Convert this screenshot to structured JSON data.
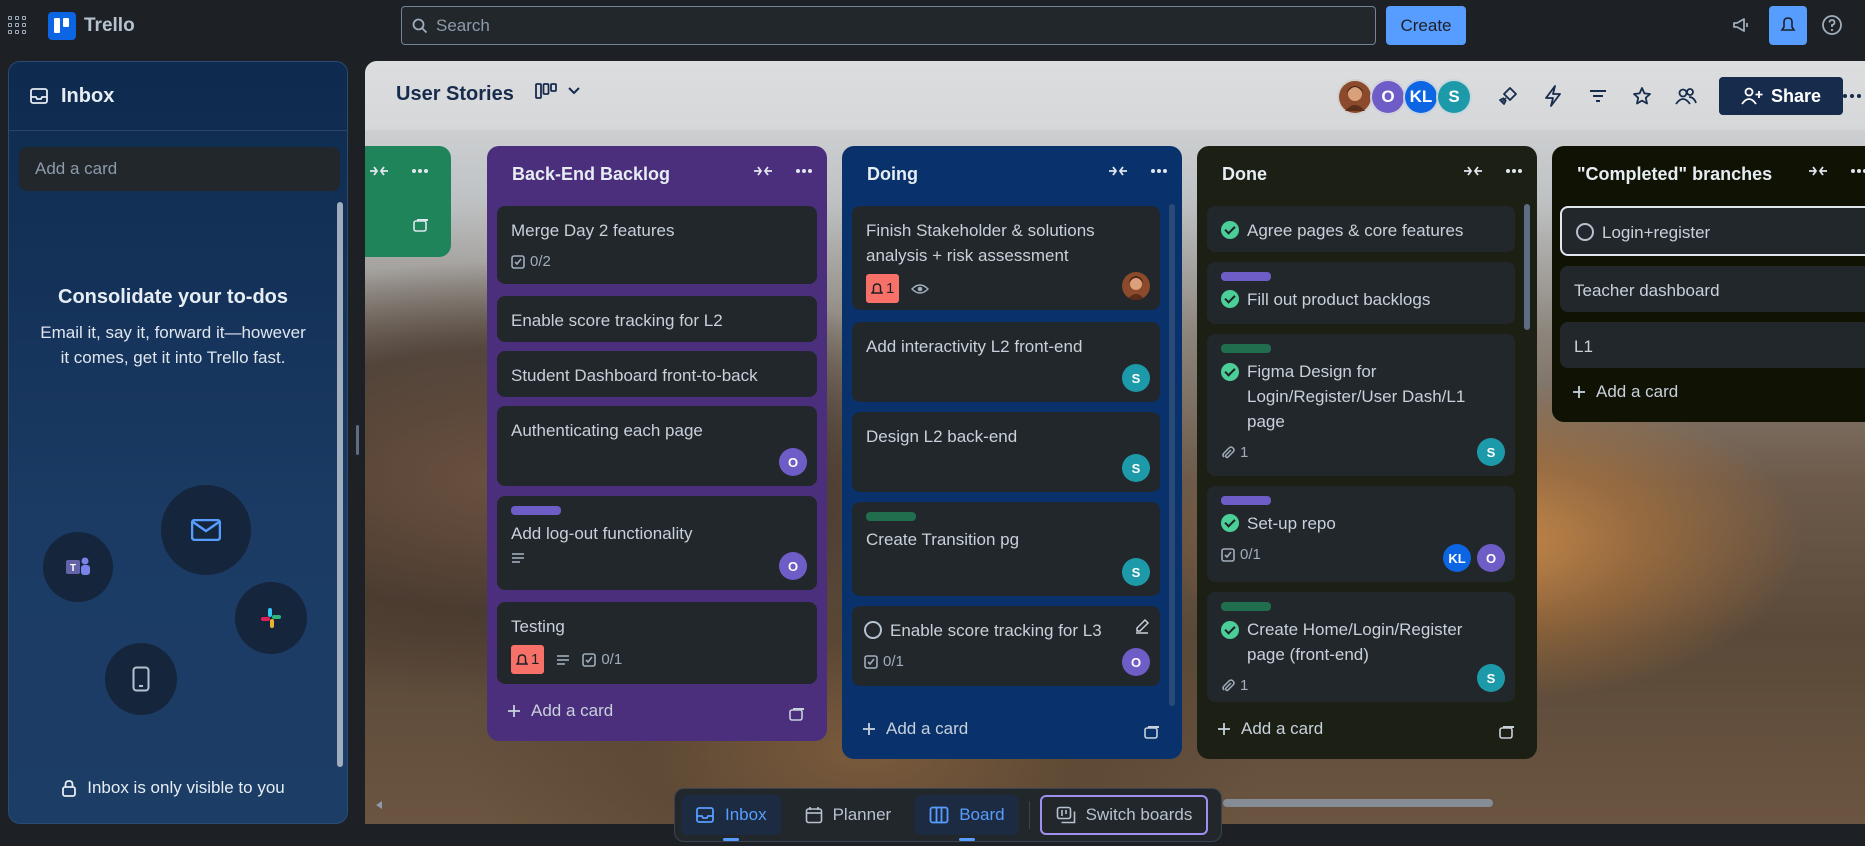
{
  "app": {
    "name": "Trello"
  },
  "search": {
    "placeholder": "Search"
  },
  "topbar": {
    "create_label": "Create"
  },
  "inbox": {
    "title": "Inbox",
    "add_card": "Add a card",
    "promo_title": "Consolidate your to-dos",
    "promo_text": "Email it, say it, forward it—however it comes, get it into Trello fast.",
    "footer": "Inbox is only visible to you"
  },
  "board": {
    "title": "User Stories",
    "share_label": "Share",
    "members": [
      {
        "initials": "",
        "color": "#8b4a2b"
      },
      {
        "initials": "O",
        "color": "#6e5dc6"
      },
      {
        "initials": "KL",
        "color": "#0c66e4"
      },
      {
        "initials": "S",
        "color": "#1d9aaa"
      }
    ]
  },
  "lists": {
    "backend": {
      "title": "Back-End Backlog",
      "add_card": "Add a card",
      "cards": [
        {
          "title": "Merge Day 2 features",
          "checklist": "0/2"
        },
        {
          "title": "Enable score tracking for L2"
        },
        {
          "title": "Student Dashboard front-to-back"
        },
        {
          "title": "Authenticating each page",
          "member": "O"
        },
        {
          "title": "Add log-out functionality",
          "label_color": "#6e5dc6",
          "member": "O"
        },
        {
          "title": "Testing",
          "due": "1",
          "checklist": "0/1"
        }
      ]
    },
    "doing": {
      "title": "Doing",
      "add_card": "Add a card",
      "cards": [
        {
          "title": "Finish Stakeholder & solutions analysis + risk assessment",
          "due": "1"
        },
        {
          "title": "Add interactivity L2 front-end",
          "member": "S"
        },
        {
          "title": "Design L2 back-end",
          "member": "S"
        },
        {
          "title": "Create Transition pg",
          "label_color": "#216e4e",
          "member": "S"
        },
        {
          "title": "Enable score tracking for L3",
          "checklist": "0/1",
          "member": "O"
        }
      ]
    },
    "done": {
      "title": "Done",
      "add_card": "Add a card",
      "cards": [
        {
          "title": "Agree pages & core features"
        },
        {
          "title": "Fill out product backlogs",
          "label_color": "#6e5dc6"
        },
        {
          "title": "Figma Design for Login/Register/User Dash/L1 page",
          "label_color": "#216e4e",
          "attachments": "1",
          "member": "S"
        },
        {
          "title": "Set-up repo",
          "label_color": "#6e5dc6",
          "checklist": "0/1",
          "members": [
            "KL",
            "O"
          ]
        },
        {
          "title": "Create Home/Login/Register page (front-end)",
          "label_color": "#216e4e",
          "attachments": "1",
          "member": "S"
        }
      ]
    },
    "completed": {
      "title": "\"Completed\" branches",
      "add_card": "Add a card",
      "cards": [
        {
          "title": "Login+register"
        },
        {
          "title": "Teacher dashboard"
        },
        {
          "title": "L1"
        }
      ]
    }
  },
  "bottom_nav": {
    "inbox": "Inbox",
    "planner": "Planner",
    "board": "Board",
    "switch": "Switch boards"
  },
  "colors": {
    "accent": "#579dff",
    "backend_list": "#4c2f7c",
    "doing_list": "#09326c",
    "done_list": "#1c1f14",
    "completed_list": "#101204",
    "green_list": "#1f845a"
  }
}
